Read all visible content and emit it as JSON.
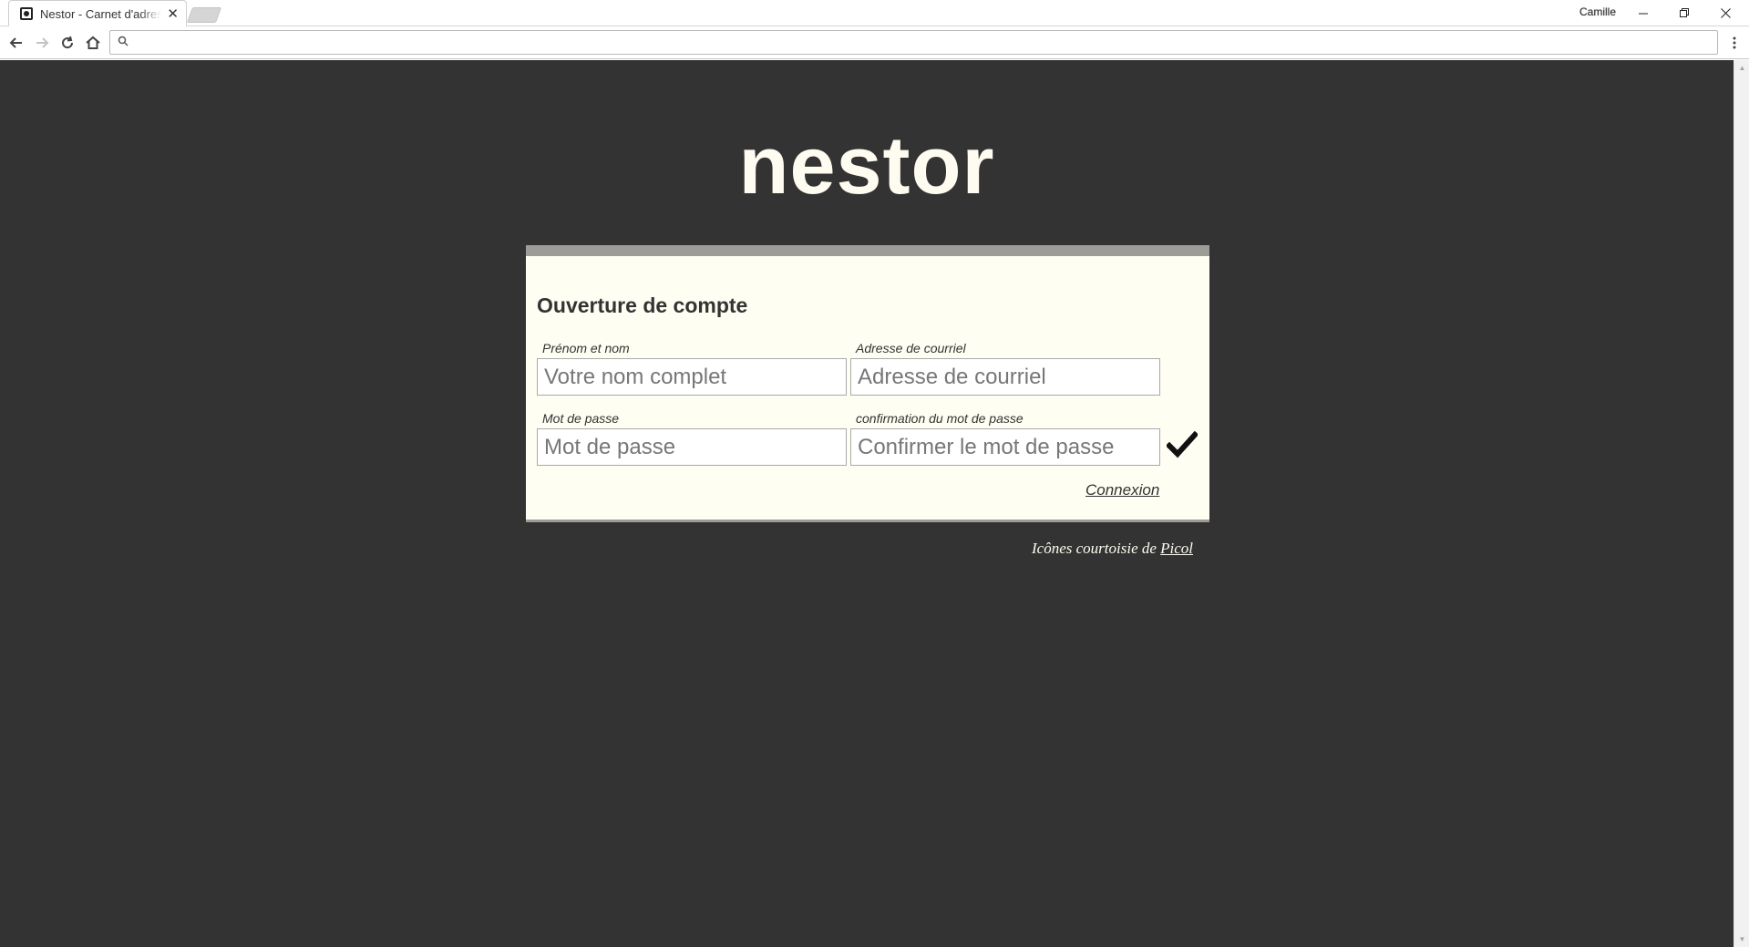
{
  "browser": {
    "tab_title": "Nestor - Carnet d'adresses",
    "profile_name": "Camille",
    "omnibox_value": "",
    "icons": {
      "back": "arrow-left-icon",
      "forward": "arrow-right-icon",
      "reload": "reload-icon",
      "home": "home-icon",
      "search": "search-icon",
      "menu": "kebab-menu-icon"
    }
  },
  "page": {
    "logo": "nestor",
    "form": {
      "title": "Ouverture de compte",
      "fields": {
        "name": {
          "label": "Prénom et nom",
          "placeholder": "Votre nom complet",
          "value": ""
        },
        "email": {
          "label": "Adresse de courriel",
          "placeholder": "Adresse de courriel",
          "value": ""
        },
        "password": {
          "label": "Mot de passe",
          "placeholder": "Mot de passe",
          "value": ""
        },
        "confirm": {
          "label": "confirmation du mot de passe",
          "placeholder": "Confirmer le mot de passe",
          "value": ""
        }
      },
      "submit_icon": "checkmark-icon",
      "login_link": "Connexion"
    },
    "footer": {
      "credit_prefix": "Icônes courtoisie de",
      "credit_link": "Picol"
    }
  },
  "colors": {
    "page_background": "#333333",
    "card_background": "#fefef2",
    "card_border": "#9e9c97",
    "logo_text": "#fefcf0"
  }
}
